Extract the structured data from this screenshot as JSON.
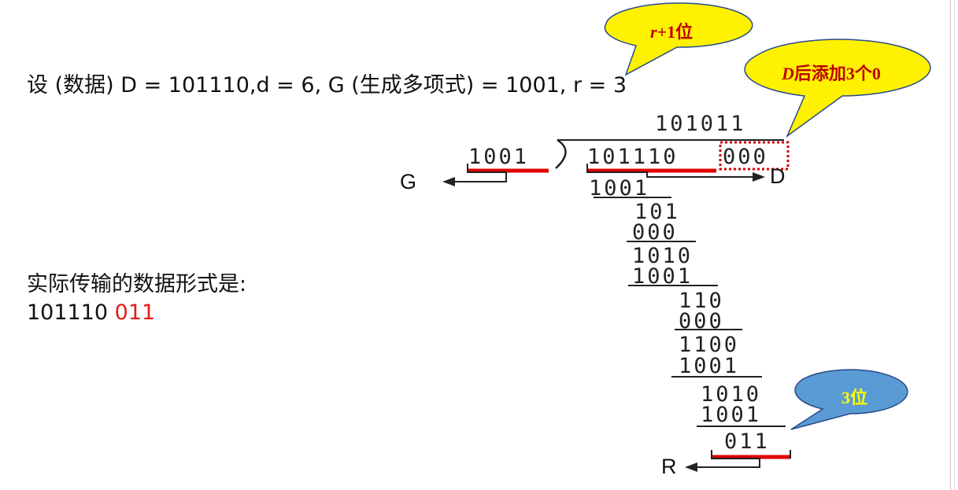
{
  "intro": {
    "params": "设 (数据)   D = 101110,d = 6,  G (生成多项式) = 1001,  r = 3"
  },
  "callouts": {
    "r_plus_1": {
      "var": "r",
      "rest": "+1位",
      "fill": "#fff200",
      "text_color": "#c00000"
    },
    "append_zeros": {
      "var": "D",
      "rest": "后添加3个0",
      "fill": "#fff200",
      "text_color": "#c00000"
    },
    "three_bits": {
      "text": "3位",
      "fill": "#5b9bd5",
      "text_color": "#ffff00"
    }
  },
  "division": {
    "quotient": "101011",
    "divisor": "1001",
    "dividend_data": "101110",
    "dividend_zeros": "000",
    "steps": [
      "1001",
      "101",
      "000",
      "1010",
      "1001",
      "110",
      "000",
      "1100",
      "1001",
      "1010",
      "1001",
      "011"
    ],
    "label_G": "G",
    "label_D": "D",
    "label_R": "R"
  },
  "result": {
    "caption": "实际传输的数据形式是:",
    "data_part": "101110",
    "crc_part": "011"
  },
  "colors": {
    "underline": "#e00000",
    "dotted_box": "#d00000"
  }
}
